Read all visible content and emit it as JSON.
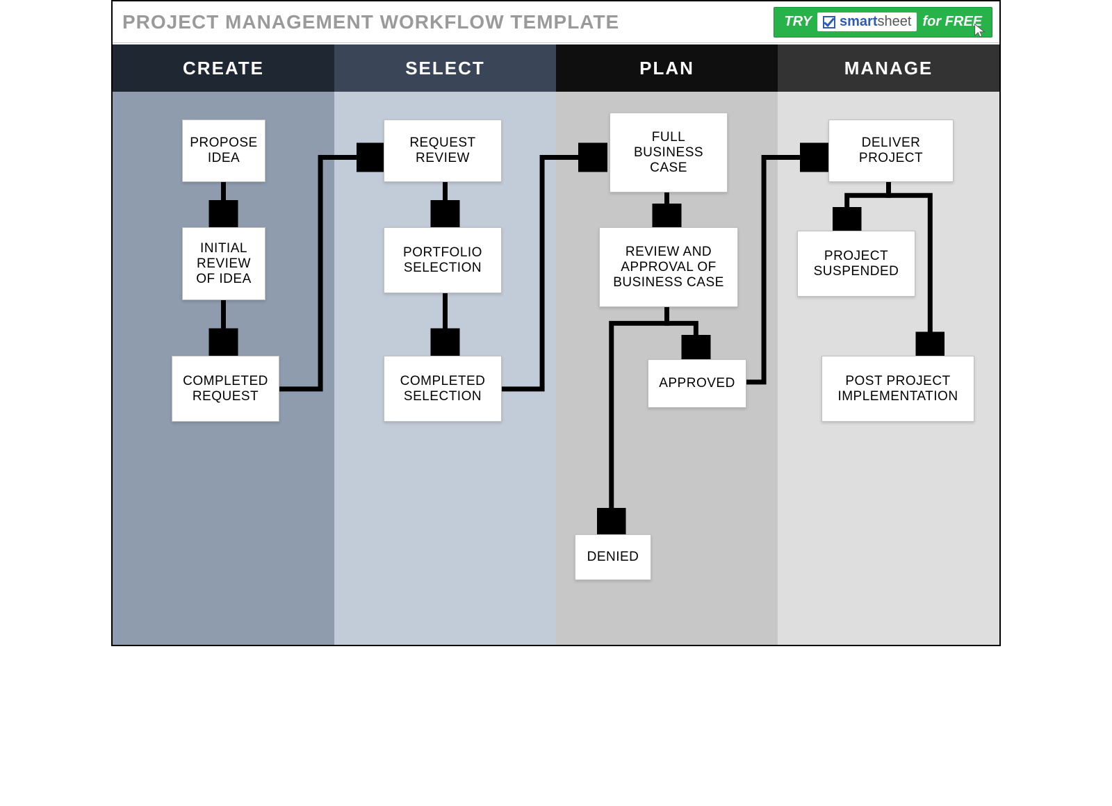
{
  "title": "PROJECT MANAGEMENT WORKFLOW TEMPLATE",
  "cta": {
    "try": "TRY",
    "brand_smart": "smart",
    "brand_sheet": "sheet",
    "for_free": "for FREE"
  },
  "lanes": [
    {
      "header": "CREATE"
    },
    {
      "header": "SELECT"
    },
    {
      "header": "PLAN"
    },
    {
      "header": "MANAGE"
    }
  ],
  "boxes": {
    "propose_idea": "PROPOSE IDEA",
    "initial_review": "INITIAL REVIEW OF IDEA",
    "completed_request": "COMPLETED REQUEST",
    "request_review": "REQUEST REVIEW",
    "portfolio_selection": "PORTFOLIO SELECTION",
    "completed_selection": "COMPLETED SELECTION",
    "full_business_case": "FULL BUSINESS CASE",
    "review_approval": "REVIEW AND APPROVAL OF BUSINESS CASE",
    "approved": "APPROVED",
    "denied": "DENIED",
    "deliver_project": "DELIVER PROJECT",
    "project_suspended": "PROJECT SUSPENDED",
    "post_project": "POST PROJECT IMPLEMENTATION"
  }
}
